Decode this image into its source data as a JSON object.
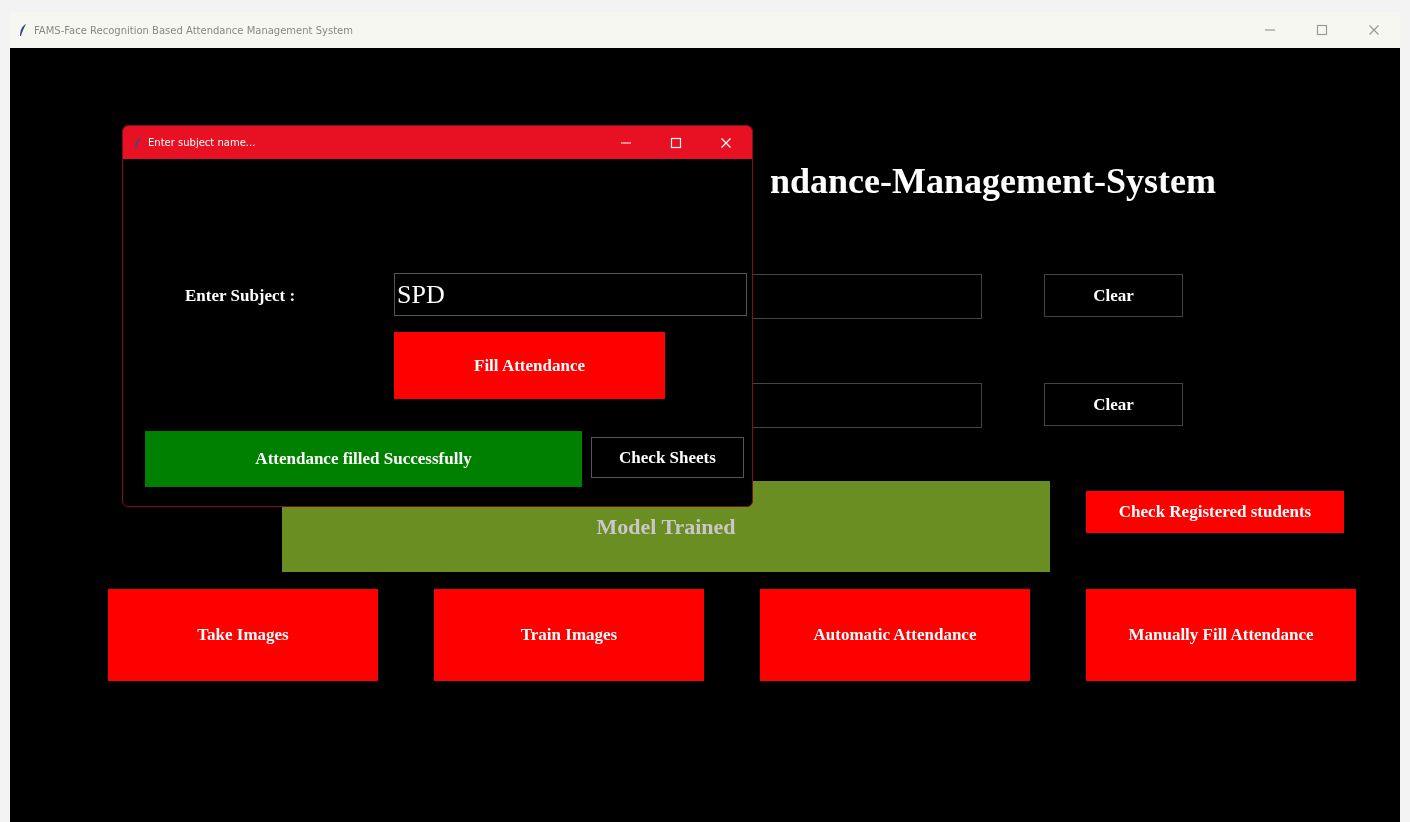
{
  "window": {
    "title": "FAMS-Face Recognition Based Attendance Management System"
  },
  "main": {
    "heading": "ndance-Management-System",
    "entry_rows": [
      {
        "clear_button": "Clear"
      },
      {
        "clear_button": "Clear"
      }
    ],
    "status_banner": "Model Trained",
    "check_registered_button": "Check Registered students",
    "actions": [
      "Take Images",
      "Train Images",
      "Automatic Attendance",
      "Manually Fill Attendance"
    ]
  },
  "dialog": {
    "title": "Enter subject name...",
    "label": "Enter Subject :",
    "subject": {
      "value": "SPD"
    },
    "fill_button": "Fill Attendance",
    "message": "Attendance filled Successfully",
    "check_sheets_button": "Check Sheets"
  }
}
